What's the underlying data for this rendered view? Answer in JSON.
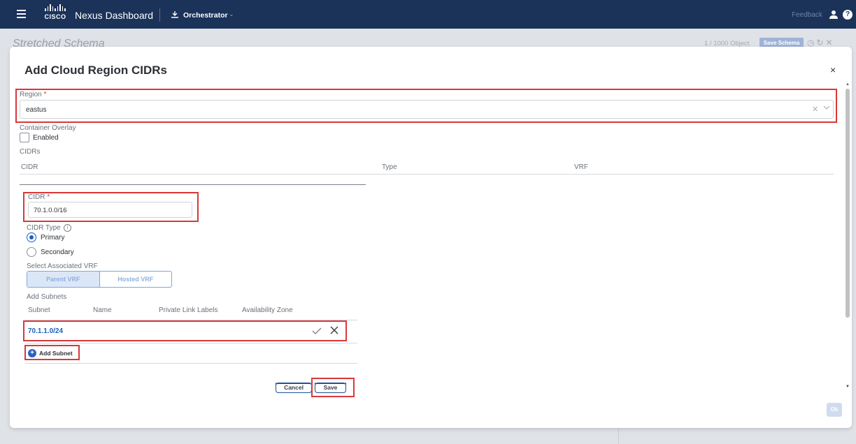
{
  "header": {
    "product_name": "Nexus Dashboard",
    "cisco_word": "CISCO",
    "app_switcher_label": "Orchestrator",
    "feedback_label": "Feedback",
    "help_label": "?"
  },
  "background": {
    "page_title": "Stretched Schema",
    "object_count": "1 / 1000 Object",
    "save_schema_label": "Save Schema"
  },
  "modal": {
    "title": "Add Cloud Region CIDRs",
    "close_label": "×",
    "region": {
      "label": "Region",
      "required_mark": "*",
      "value": "eastus"
    },
    "container_overlay": {
      "label": "Container Overlay",
      "checkbox_label": "Enabled",
      "checked": false
    },
    "cidrs_section_label": "CIDRs",
    "cidrs_table": {
      "columns": [
        "CIDR",
        "Type",
        "VRF"
      ]
    },
    "cidr_form": {
      "cidr_label": "CIDR",
      "required_mark": "*",
      "cidr_value": "70.1.0.0/16",
      "cidr_type_label": "CIDR Type",
      "cidr_type_options": [
        {
          "label": "Primary",
          "selected": true
        },
        {
          "label": "Secondary",
          "selected": false
        }
      ],
      "vrf_label": "Select Associated VRF",
      "vrf_options": [
        {
          "label": "Parent VRF",
          "active": true
        },
        {
          "label": "Hosted VRF",
          "active": false
        }
      ],
      "subnets_label": "Add Subnets",
      "subnet_columns": [
        "Subnet",
        "Name",
        "Private Link Labels",
        "Availability Zone"
      ],
      "subnet_value": "70.1.1.0/24",
      "add_subnet_label": "Add Subnet",
      "cancel_label": "Cancel",
      "save_label": "Save"
    },
    "ok_label": "Ok"
  },
  "colors": {
    "nav_bg": "#1b3259",
    "accent_blue": "#1d5fbf",
    "highlight_red": "#d9383a"
  }
}
